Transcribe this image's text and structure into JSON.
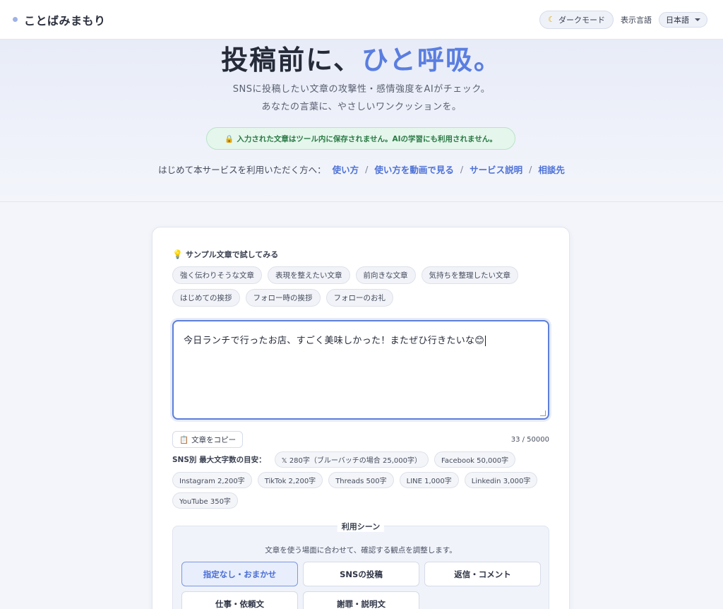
{
  "header": {
    "brand": "ことばみまもり",
    "dark_mode_label": "ダークモード",
    "language_label": "表示言語",
    "language_value": "日本語"
  },
  "hero": {
    "title_main": "投稿前に、",
    "title_accent": "ひと呼吸。",
    "subtitle_line1": "SNSに投稿したい文章の攻撃性・感情強度をAIがチェック。",
    "subtitle_line2": "あなたの言葉に、やさしいワンクッションを。",
    "privacy_notice": "入力された文章はツール内に保存されません。AIの学習にも利用されません。",
    "intro_prefix": "はじめて本サービスを利用いただく方へ：",
    "links": [
      "使い方",
      "使い方を動画で見る",
      "サービス説明",
      "相談先"
    ],
    "link_separator": "/"
  },
  "samples": {
    "title": "サンプル文章で試してみる",
    "chips": [
      "強く伝わりそうな文章",
      "表現を整えたい文章",
      "前向きな文章",
      "気持ちを整理したい文章",
      "はじめての挨拶",
      "フォロー時の挨拶",
      "フォローのお礼"
    ]
  },
  "editor": {
    "text": "今日ランチで行ったお店、すごく美味しかった！またぜひ行きたいな😊",
    "copy_label": "文章をコピー",
    "counter": "33 / 50000"
  },
  "limits": {
    "label": "SNS別 最大文字数の目安：",
    "items": [
      "𝕏 280字（ブルーバッチの場合 25,000字）",
      "Facebook 50,000字",
      "Instagram 2,200字",
      "TikTok 2,200字",
      "Threads 500字",
      "LINE 1,000字",
      "Linkedin 3,000字",
      "YouTube 350字"
    ]
  },
  "scene": {
    "legend": "利用シーン",
    "description": "文章を使う場面に合わせて、確認する観点を調整します。",
    "options": [
      "指定なし・おまかせ",
      "SNSの投稿",
      "返信・コメント",
      "仕事・依頼文",
      "謝罪・説明文"
    ],
    "selected_index": 0
  },
  "colors": {
    "accent": "#5a7ee0",
    "link": "#4e72d6",
    "privacy_text": "#2a7a45",
    "privacy_bg": "#e5f6ec"
  },
  "icons": {
    "dark_mode": "moon-icon",
    "privacy": "lock-icon",
    "samples": "lightbulb-icon",
    "copy": "clipboard-icon",
    "language": "chevron-down-icon"
  }
}
